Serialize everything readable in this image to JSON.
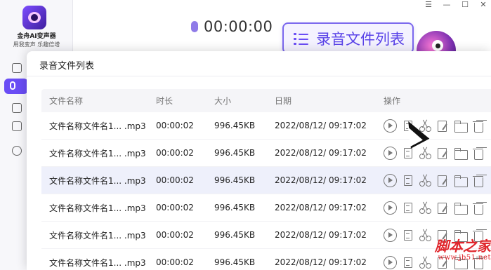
{
  "app": {
    "name": "金舟AI变声器",
    "slogan": "用我变声 乐趣倍增"
  },
  "window_controls": [
    "☰",
    "—",
    "☐",
    "✕"
  ],
  "recorder": {
    "timer": "00:00:00",
    "list_button_label": "录音文件列表"
  },
  "dialog": {
    "title": "录音文件列表",
    "columns": {
      "name": "文件名称",
      "duration": "时长",
      "size": "大小",
      "date": "日期",
      "ops": "操作"
    },
    "rows": [
      {
        "name": "文件名称文件名1... .mp3",
        "duration": "00:00:02",
        "size": "996.45KB",
        "date": "2022/08/12/ 09:17:02"
      },
      {
        "name": "文件名称文件名1... .mp3",
        "duration": "00:00:02",
        "size": "996.45KB",
        "date": "2022/08/12/ 09:17:02"
      },
      {
        "name": "文件名称文件名1... .mp3",
        "duration": "00:00:02",
        "size": "996.45KB",
        "date": "2022/08/12/ 09:17:02"
      },
      {
        "name": "文件名称文件名1... .mp3",
        "duration": "00:00:02",
        "size": "996.45KB",
        "date": "2022/08/12/ 09:17:02"
      },
      {
        "name": "文件名称文件名1... .mp3",
        "duration": "00:00:02",
        "size": "996.45KB",
        "date": "2022/08/12/ 09:17:02"
      },
      {
        "name": "文件名称文件名1... .mp3",
        "duration": "00:00:02",
        "size": "996.45KB",
        "date": "2022/08/12/ 09:17:02"
      }
    ],
    "row_actions": [
      "play-icon",
      "copy-icon",
      "cut-icon",
      "edit-icon",
      "folder-icon",
      "delete-icon"
    ],
    "highlight_row": 2
  },
  "watermark": {
    "main": "脚本之家",
    "url": "www.jb51.net"
  },
  "colors": {
    "accent": "#6a4df5",
    "highlight_row": "#eef0fb",
    "watermark": "#e0262c"
  }
}
